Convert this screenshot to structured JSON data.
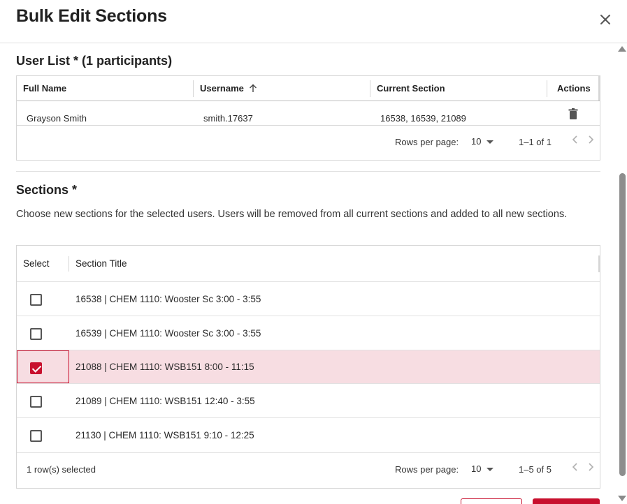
{
  "dialog": {
    "title": "Bulk Edit Sections"
  },
  "user_list": {
    "heading": "User List * (1 participants)",
    "columns": {
      "full_name": "Full Name",
      "username": "Username",
      "current_section": "Current Section",
      "actions": "Actions"
    },
    "rows": [
      {
        "full_name": "Grayson Smith",
        "username": "smith.17637",
        "current_section": "16538, 16539, 21089"
      }
    ],
    "rows_per_page_label": "Rows per page:",
    "rows_per_page_value": "10",
    "range": "1–1 of 1"
  },
  "sections": {
    "heading": "Sections *",
    "description": "Choose new sections for the selected users. Users will be removed from all current sections and added to all new sections.",
    "columns": {
      "select": "Select",
      "section_title": "Section Title"
    },
    "rows": [
      {
        "title": "16538 | CHEM 1110: Wooster Sc 3:00 - 3:55",
        "checked": false
      },
      {
        "title": "16539 | CHEM 1110: Wooster Sc 3:00 - 3:55",
        "checked": false
      },
      {
        "title": "21088 | CHEM 1110: WSB151 8:00 - 11:15",
        "checked": true
      },
      {
        "title": "21089 | CHEM 1110: WSB151 12:40 - 3:55",
        "checked": false
      },
      {
        "title": "21130 | CHEM 1110: WSB151 9:10 - 12:25",
        "checked": false
      }
    ],
    "selected_count": "1 row(s) selected",
    "rows_per_page_label": "Rows per page:",
    "rows_per_page_value": "10",
    "range": "1–5 of 5"
  },
  "colors": {
    "accent": "#c8102e",
    "selected_row": "#f7dde2"
  },
  "icons": {
    "close": "close-icon",
    "sort": "arrow-up-icon",
    "delete": "trash-icon",
    "dropdown": "caret-down-icon",
    "prev": "chevron-left-icon",
    "next": "chevron-right-icon"
  }
}
